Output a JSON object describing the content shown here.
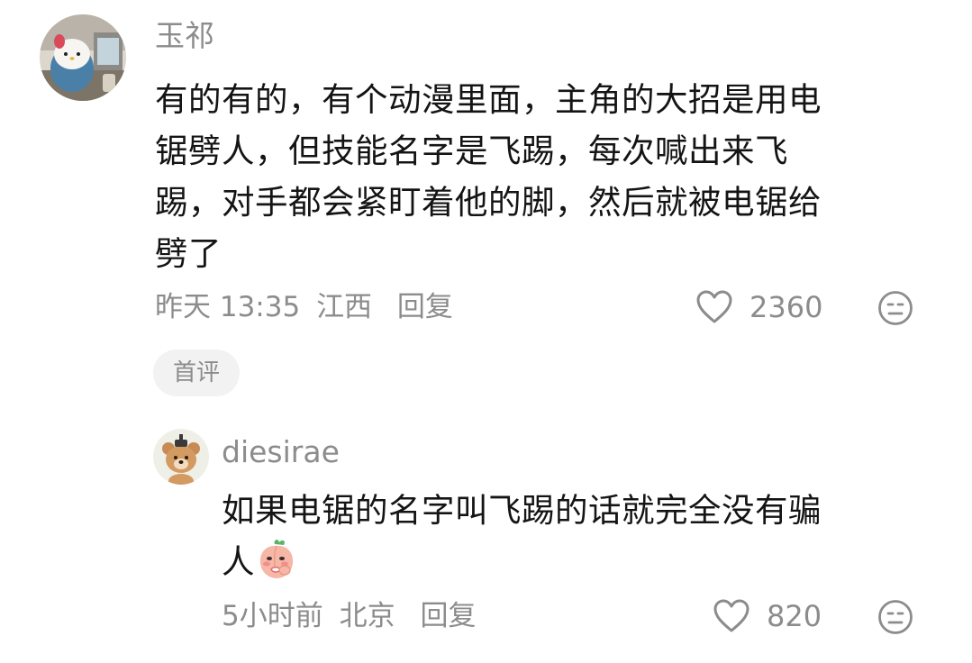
{
  "comment": {
    "username": "玉祁",
    "lines": [
      "有的有的，有个动漫里面，主角的大招是用电",
      "锯劈人，但技能名字是飞踢，每次喊出来飞",
      "踢，对手都会紧盯着他的脚，然后就被电锯给",
      "劈了"
    ],
    "time": "昨天 13:35",
    "location": "江西",
    "reply_label": "回复",
    "likes": "2360",
    "badge": "首评",
    "avatar_icon": "hello-kitty-avatar",
    "like_icon": "heart-outline-icon",
    "dislike_icon": "meh-face-icon"
  },
  "reply": {
    "username": "diesirae",
    "lines": [
      "如果电锯的名字叫飞踢的话就完全没有骗",
      "人"
    ],
    "emoji": "peach-emoji",
    "time": "5小时前",
    "location": "北京",
    "reply_label": "回复",
    "likes": "820",
    "avatar_icon": "teddy-bear-avatar",
    "like_icon": "heart-outline-icon",
    "dislike_icon": "meh-face-icon"
  },
  "colors": {
    "text_primary": "#141414",
    "text_secondary": "#8c8c8c",
    "badge_bg": "#f2f2f2"
  }
}
